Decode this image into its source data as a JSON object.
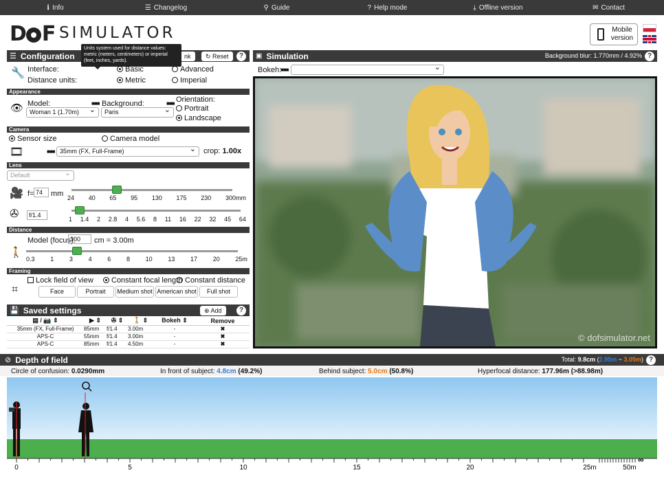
{
  "nav": [
    "Info",
    "Changelog",
    "Guide",
    "Help mode",
    "Offline version",
    "Contact"
  ],
  "header": {
    "logo": "SIMULATOR",
    "mobile": "Mobile version"
  },
  "config": {
    "title": "Configuration",
    "link_label": "nk",
    "reset_label": "Reset",
    "tooltip": "Units system used for distance values: metric (meters, centimeters) or imperial (feet, inches, yards).",
    "interface_label": "Interface:",
    "basic": "Basic",
    "advanced": "Advanced",
    "units_label": "Distance units:",
    "metric": "Metric",
    "imperial": "Imperial",
    "appearance": "Appearance",
    "model_label": "Model:",
    "model_value": "Woman 1 (1.70m)",
    "background_label": "Background:",
    "background_value": "Paris",
    "orientation_label": "Orientation:",
    "portrait": "Portrait",
    "landscape": "Landscape",
    "camera": "Camera",
    "sensor_size": "Sensor size",
    "camera_model": "Camera model",
    "sensor_value": "35mm (FX, Full-Frame)",
    "crop_label": "crop:",
    "crop_value": "1.00x",
    "lens": "Lens",
    "lens_value": "Default",
    "focal_value": "74",
    "focal_unit": "mm",
    "focal_fraction": 0.28,
    "focal_ticks": [
      "24",
      "40",
      "65",
      "95",
      "130",
      "175",
      "230",
      "300mm"
    ],
    "aperture_value": "1.4",
    "aperture_prefix": "f/",
    "aperture_fraction": 0.05,
    "aperture_ticks": [
      "1",
      "1.4",
      "2",
      "2.8",
      "4",
      "5.6",
      "8",
      "11",
      "16",
      "22",
      "32",
      "45",
      "64"
    ],
    "distance": "Distance",
    "focus_label": "Model (focus):",
    "focus_value": "300",
    "focus_result": "cm = 3.00m",
    "focus_fraction": 0.24,
    "distance_ticks": [
      "0.3",
      "1",
      "3",
      "4",
      "6",
      "8",
      "10",
      "13",
      "17",
      "20",
      "25m"
    ],
    "framing": "Framing",
    "lock_fov": "Lock field of view",
    "const_focal": "Constant focal length",
    "const_distance": "Constant distance",
    "frame_buttons": [
      "Face",
      "Portrait",
      "Medium shot",
      "American shot",
      "Full shot"
    ]
  },
  "saved": {
    "title": "Saved settings",
    "add_label": "Add",
    "headers": [
      "Bokeh",
      "Remove"
    ],
    "rows": [
      [
        "35mm (FX, Full-Frame)",
        "85mm",
        "f/1.4",
        "3.00m",
        "-",
        "✖"
      ],
      [
        "APS-C",
        "55mm",
        "f/1.4",
        "3.00m",
        "-",
        "✖"
      ],
      [
        "APS-C",
        "85mm",
        "f/1.4",
        "4.50m",
        "-",
        "✖"
      ]
    ]
  },
  "simulation": {
    "title": "Simulation",
    "blur": "Background blur: 1.770mm / 4.92%",
    "bokeh_label": "Bokeh:",
    "watermark": "© dofsimulator.net"
  },
  "dof": {
    "title": "Depth of field",
    "total_prefix": "Total:",
    "total": "9.8cm",
    "near_far_near": "2.95m",
    "near_far_far": "3.05m",
    "coc_label": "Circle of confusion:",
    "coc_value": "0.0290mm",
    "front_label": "In front of subject:",
    "front_value": "4.8cm",
    "front_pct": "(49.2%)",
    "behind_label": "Behind subject:",
    "behind_value": "5.0cm",
    "behind_pct": "(50.8%)",
    "hyper_label": "Hyperfocal distance:",
    "hyper_value": "177.96m (>88.98m)",
    "scale": [
      "0",
      "5",
      "10",
      "15",
      "20",
      "25m",
      "50m"
    ]
  },
  "colors": {
    "accent_blue": "#3a7fd5",
    "accent_orange": "#e07a1f",
    "slider_green": "#4caf50",
    "bar_dark": "#3a3a3a"
  }
}
